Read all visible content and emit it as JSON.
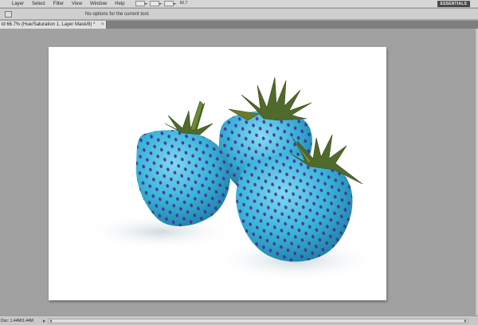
{
  "menubar": {
    "items": [
      "Layer",
      "Select",
      "Filter",
      "View",
      "Window",
      "Help"
    ],
    "zoom_value": "66.7",
    "workspace_button": "ESSENTIALS"
  },
  "options_bar": {
    "message": "No options for the current tool."
  },
  "document": {
    "tab_title": "ld 66.7% (Hue/Saturation 1, Layer Mask/8) *",
    "tab_close": "×"
  },
  "status": {
    "doc_size": "Doc: 1.44M/1.44M"
  },
  "colors": {
    "strawberry_body": "#3ab5d8",
    "seeds": "#4a2aa0",
    "leaves": "#4f6a2a",
    "ui_chrome": "#d6d6d6",
    "workspace_bg": "#a1a1a1"
  },
  "icons": {
    "tool_preset": "rect-marquee-icon",
    "menu_tools": [
      "view-extras-icon",
      "screen-mode-icon",
      "arrange-documents-icon"
    ]
  }
}
